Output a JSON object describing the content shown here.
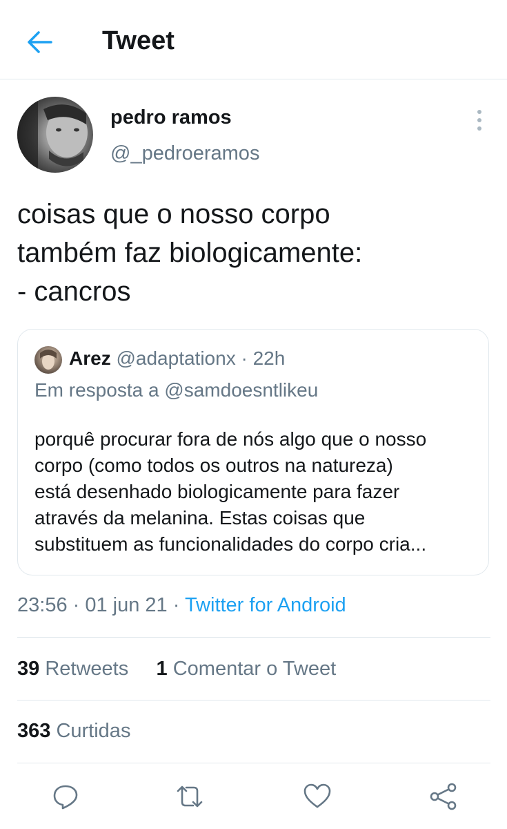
{
  "header": {
    "title": "Tweet",
    "back_icon": "arrow-left-icon",
    "accent": "#1da1f2"
  },
  "author": {
    "name": "pedro ramos",
    "handle": "@_pedroeramos"
  },
  "tweet": {
    "lines": [
      "coisas que o nosso corpo",
      "também faz biologicamente:",
      "- cancros"
    ]
  },
  "quote": {
    "name": "Arez",
    "handle": "@adaptationx",
    "separator": " · ",
    "time": "22h",
    "reply_to": "Em resposta a @samdoesntlikeu",
    "lines": [
      "porquê procurar fora de nós algo que o nosso",
      "corpo (como todos os outros na natureza)",
      "está desenhado biologicamente para fazer",
      "através da melanina. Estas coisas que",
      "substituem as funcionalidades do corpo cria..."
    ]
  },
  "meta": {
    "time": "23:56",
    "sep1": " · ",
    "date": "01 jun 21",
    "sep2": " · ",
    "source": "Twitter for Android"
  },
  "stats": {
    "retweets_count": "39",
    "retweets_label": "Retweets",
    "quotes_count": "1",
    "quotes_label": "Comentar o Tweet",
    "likes_count": "363",
    "likes_label": "Curtidas"
  },
  "actions": {
    "reply_icon": "reply-icon",
    "retweet_icon": "retweet-icon",
    "like_icon": "heart-icon",
    "share_icon": "share-icon",
    "icon_color": "#657786"
  }
}
